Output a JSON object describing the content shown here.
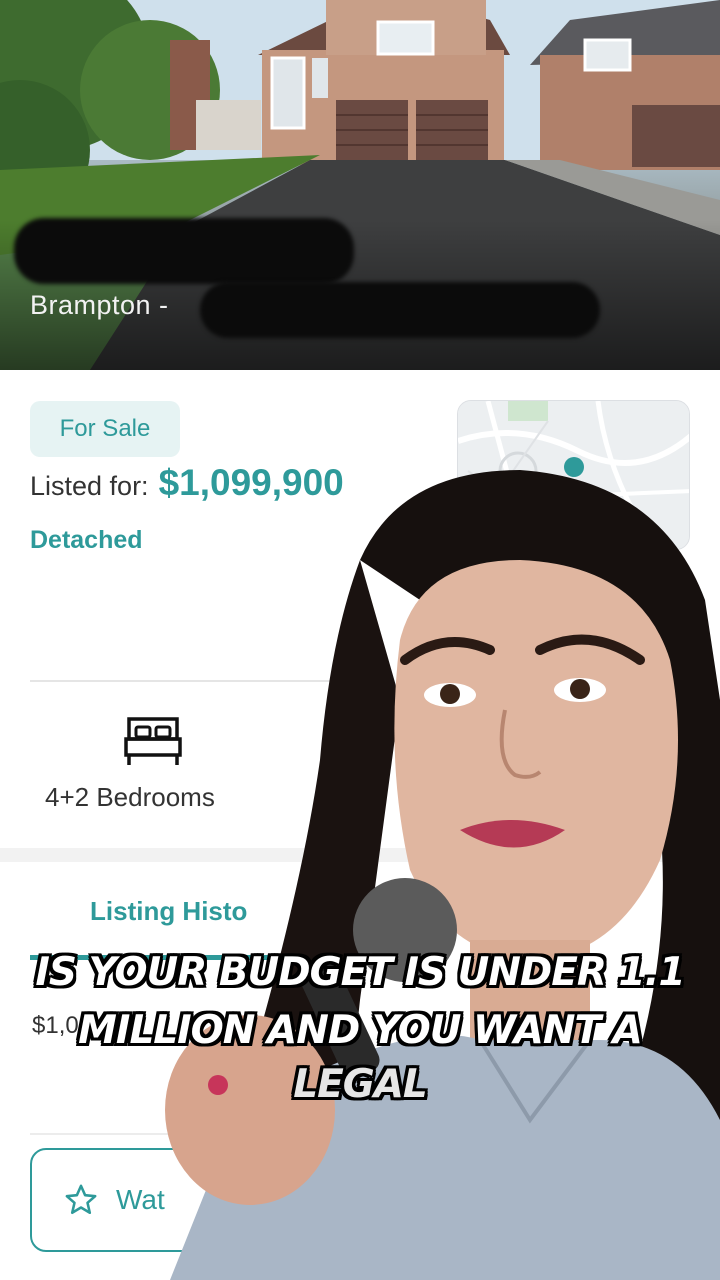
{
  "hero": {
    "city_label": "Brampton -"
  },
  "listing": {
    "status_badge": "For Sale",
    "listed_label": "Listed for:",
    "price": "$1,099,900",
    "property_type": "Detached",
    "bedrooms_label": "4+2 Bedrooms",
    "history_tab_label": "Listing Histo",
    "history_price_partial": "$1,0",
    "watch_label": "Wat"
  },
  "captions": {
    "line1": "IS YOUR BUDGET IS UNDER 1.1",
    "line2": "MILLION AND YOU WANT A",
    "line3": "LEGAL"
  },
  "colors": {
    "accent": "#2e9a9a",
    "badge_bg": "#e6f3f3"
  },
  "icons": [
    "bed-icon",
    "star-icon",
    "map-pin-icon"
  ]
}
